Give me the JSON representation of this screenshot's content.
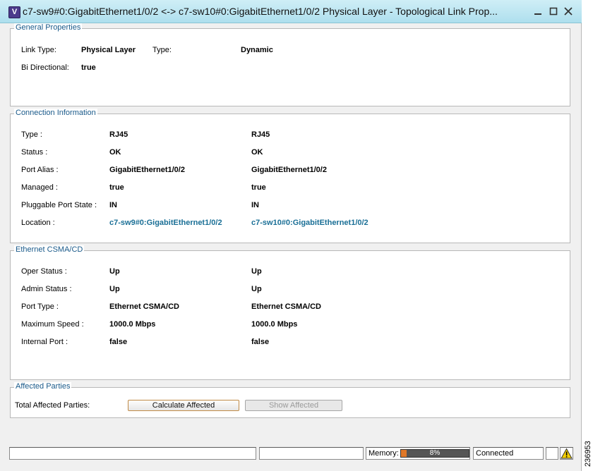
{
  "window": {
    "title": "c7-sw9#0:GigabitEthernet1/0/2 <-> c7-sw10#0:GigabitEthernet1/0/2 Physical Layer - Topological Link Prop...",
    "icon_letter": "V"
  },
  "general": {
    "legend": "General Properties",
    "link_type_label": "Link Type:",
    "link_type_value": "Physical Layer",
    "type_label": "Type:",
    "type_value": "Dynamic",
    "bidir_label": "Bi Directional:",
    "bidir_value": "true"
  },
  "connection": {
    "legend": "Connection Information",
    "rows": [
      {
        "label": "Type :",
        "a": "RJ45",
        "b": "RJ45"
      },
      {
        "label": "Status :",
        "a": "OK",
        "b": "OK"
      },
      {
        "label": "Port Alias :",
        "a": "GigabitEthernet1/0/2",
        "b": "GigabitEthernet1/0/2"
      },
      {
        "label": "Managed :",
        "a": "true",
        "b": "true"
      },
      {
        "label": "Pluggable Port State :",
        "a": "IN",
        "b": "IN"
      },
      {
        "label": "Location :",
        "a": "c7-sw9#0:GigabitEthernet1/0/2",
        "b": "c7-sw10#0:GigabitEthernet1/0/2"
      }
    ]
  },
  "ethernet": {
    "legend": "Ethernet CSMA/CD",
    "rows": [
      {
        "label": "Oper Status :",
        "a": "Up",
        "b": "Up"
      },
      {
        "label": "Admin Status :",
        "a": "Up",
        "b": "Up"
      },
      {
        "label": "Port Type :",
        "a": "Ethernet CSMA/CD",
        "b": "Ethernet CSMA/CD"
      },
      {
        "label": "Maximum Speed :",
        "a": "1000.0 Mbps",
        "b": "1000.0 Mbps"
      },
      {
        "label": "Internal Port :",
        "a": "false",
        "b": "false"
      }
    ]
  },
  "affected": {
    "legend": "Affected Parties",
    "total_label": "Total Affected Parties:",
    "calculate_button": "Calculate Affected",
    "show_button": "Show Affected"
  },
  "statusbar": {
    "memory_label": "Memory:",
    "memory_percent": 8,
    "memory_text": "8%",
    "connection_status": "Connected"
  },
  "side_code": "236953"
}
